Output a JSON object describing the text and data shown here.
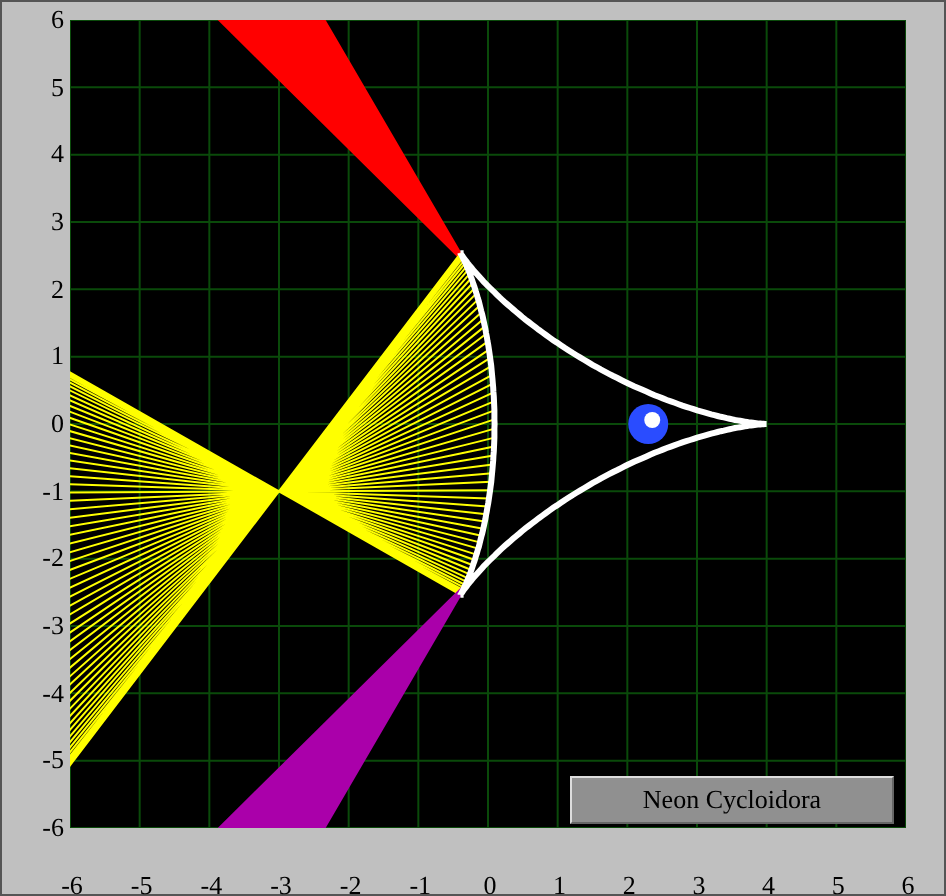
{
  "plot": {
    "y_ticks": [
      "6",
      "5",
      "4",
      "3",
      "2",
      "1",
      "0",
      "-1",
      "-2",
      "-3",
      "-4",
      "-5",
      "-6"
    ],
    "x_ticks": [
      "-6",
      "-5",
      "-4",
      "-3",
      "-2",
      "-1",
      "0",
      "1",
      "2",
      "3",
      "4",
      "5",
      "6"
    ]
  },
  "button": {
    "label": "Neon Cycloidora"
  }
}
